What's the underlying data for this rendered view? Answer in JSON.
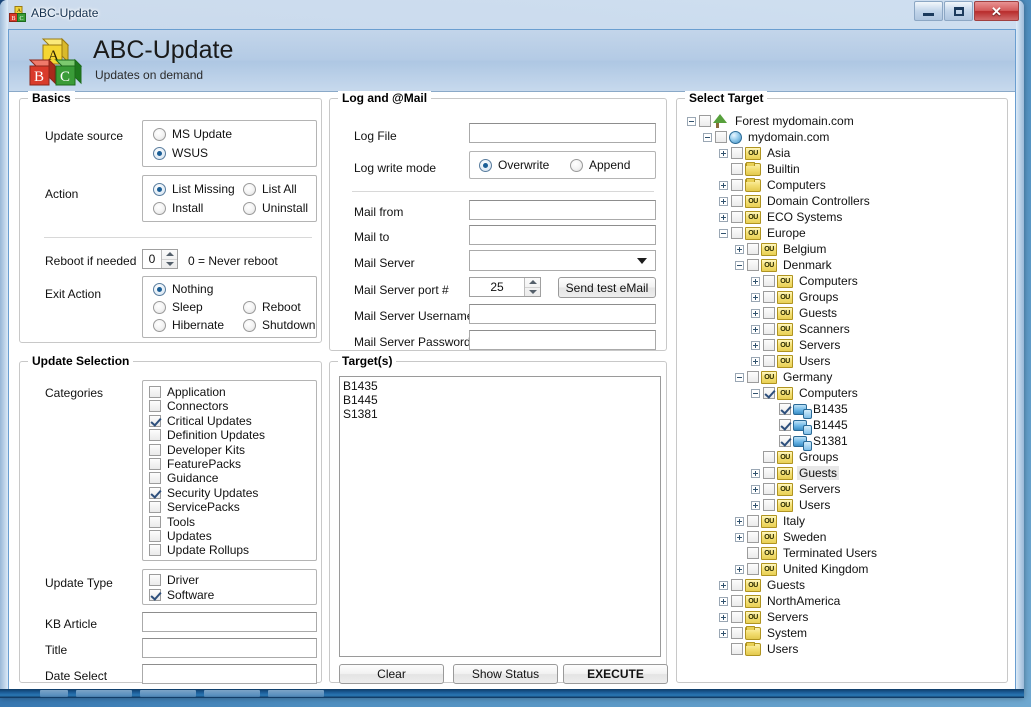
{
  "window": {
    "title": "ABC-Update",
    "icon": "abc-blocks-icon",
    "controls": {
      "minimize": "Minimize",
      "maximize": "Maximize",
      "close": "Close"
    }
  },
  "banner": {
    "app_title": "ABC-Update",
    "subtitle": "Updates on demand",
    "logo": "abc-blocks-logo"
  },
  "basics": {
    "title": "Basics",
    "update_source": {
      "label": "Update source",
      "options": [
        {
          "label": "MS Update",
          "selected": false
        },
        {
          "label": "WSUS",
          "selected": true
        }
      ]
    },
    "action": {
      "label": "Action",
      "options": [
        {
          "label": "List Missing",
          "selected": true
        },
        {
          "label": "List All",
          "selected": false
        },
        {
          "label": "Install",
          "selected": false
        },
        {
          "label": "Uninstall",
          "selected": false
        }
      ]
    },
    "reboot": {
      "label": "Reboot if needed",
      "value": "0",
      "hint": "0 = Never reboot"
    },
    "exit_action": {
      "label": "Exit Action",
      "options": [
        {
          "label": "Nothing",
          "selected": true
        },
        {
          "label": "Sleep",
          "selected": false
        },
        {
          "label": "Reboot",
          "selected": false
        },
        {
          "label": "Hibernate",
          "selected": false
        },
        {
          "label": "Shutdown",
          "selected": false
        }
      ]
    }
  },
  "update_selection": {
    "title": "Update Selection",
    "categories_label": "Categories",
    "categories": [
      {
        "label": "Application",
        "checked": false
      },
      {
        "label": "Connectors",
        "checked": false
      },
      {
        "label": "Critical Updates",
        "checked": true
      },
      {
        "label": "Definition Updates",
        "checked": false
      },
      {
        "label": "Developer Kits",
        "checked": false
      },
      {
        "label": "FeaturePacks",
        "checked": false
      },
      {
        "label": "Guidance",
        "checked": false
      },
      {
        "label": "Security Updates",
        "checked": true
      },
      {
        "label": "ServicePacks",
        "checked": false
      },
      {
        "label": "Tools",
        "checked": false
      },
      {
        "label": "Updates",
        "checked": false
      },
      {
        "label": "Update Rollups",
        "checked": false
      }
    ],
    "update_type_label": "Update Type",
    "update_types": [
      {
        "label": "Driver",
        "checked": false
      },
      {
        "label": "Software",
        "checked": true
      }
    ],
    "kb_article": {
      "label": "KB Article",
      "value": ""
    },
    "title_field": {
      "label": "Title",
      "value": ""
    },
    "date_select": {
      "label": "Date Select",
      "value": ""
    }
  },
  "log_mail": {
    "title": "Log  and  @Mail",
    "log_file": {
      "label": "Log File",
      "value": ""
    },
    "log_write_mode": {
      "label": "Log write mode",
      "options": [
        {
          "label": "Overwrite",
          "selected": true
        },
        {
          "label": "Append",
          "selected": false
        }
      ]
    },
    "mail_from": {
      "label": "Mail from",
      "value": ""
    },
    "mail_to": {
      "label": "Mail to",
      "value": ""
    },
    "mail_server": {
      "label": "Mail Server",
      "value": ""
    },
    "mail_server_port": {
      "label": "Mail Server port #",
      "value": "25"
    },
    "send_test_button": "Send test eMail",
    "mail_username": {
      "label": "Mail Server Username",
      "value": ""
    },
    "mail_password": {
      "label": "Mail Server Password",
      "value": ""
    }
  },
  "targets": {
    "title": "Target(s)",
    "items": [
      "B1435",
      "B1445",
      "S1381"
    ],
    "buttons": {
      "clear": "Clear",
      "show_status": "Show Status",
      "execute": "EXECUTE"
    }
  },
  "select_target": {
    "title": "Select Target",
    "tree": [
      {
        "label": "Forest mydomain.com",
        "depth": 0,
        "expander": "minus",
        "checkbox": false,
        "icon": "tree-icon",
        "highlight": false
      },
      {
        "label": "mydomain.com",
        "depth": 1,
        "expander": "minus",
        "checkbox": false,
        "icon": "globe-icon",
        "highlight": false
      },
      {
        "label": "Asia",
        "depth": 2,
        "expander": "plus",
        "checkbox": false,
        "icon": "ou-icon",
        "highlight": false
      },
      {
        "label": "Builtin",
        "depth": 2,
        "expander": "none",
        "checkbox": false,
        "icon": "folder-icon",
        "highlight": false
      },
      {
        "label": "Computers",
        "depth": 2,
        "expander": "plus",
        "checkbox": false,
        "icon": "folder-icon",
        "highlight": false
      },
      {
        "label": "Domain Controllers",
        "depth": 2,
        "expander": "plus",
        "checkbox": false,
        "icon": "ou-icon",
        "highlight": false
      },
      {
        "label": "ECO Systems",
        "depth": 2,
        "expander": "plus",
        "checkbox": false,
        "icon": "ou-icon",
        "highlight": false
      },
      {
        "label": "Europe",
        "depth": 2,
        "expander": "minus",
        "checkbox": false,
        "icon": "ou-icon",
        "highlight": false
      },
      {
        "label": "Belgium",
        "depth": 3,
        "expander": "plus",
        "checkbox": false,
        "icon": "ou-icon",
        "highlight": false
      },
      {
        "label": "Denmark",
        "depth": 3,
        "expander": "minus",
        "checkbox": false,
        "icon": "ou-icon",
        "highlight": false
      },
      {
        "label": "Computers",
        "depth": 4,
        "expander": "plus",
        "checkbox": false,
        "icon": "ou-icon",
        "highlight": false
      },
      {
        "label": "Groups",
        "depth": 4,
        "expander": "plus",
        "checkbox": false,
        "icon": "ou-icon",
        "highlight": false
      },
      {
        "label": "Guests",
        "depth": 4,
        "expander": "plus",
        "checkbox": false,
        "icon": "ou-icon",
        "highlight": false
      },
      {
        "label": "Scanners",
        "depth": 4,
        "expander": "plus",
        "checkbox": false,
        "icon": "ou-icon",
        "highlight": false
      },
      {
        "label": "Servers",
        "depth": 4,
        "expander": "plus",
        "checkbox": false,
        "icon": "ou-icon",
        "highlight": false
      },
      {
        "label": "Users",
        "depth": 4,
        "expander": "plus",
        "checkbox": false,
        "icon": "ou-icon",
        "highlight": false
      },
      {
        "label": "Germany",
        "depth": 3,
        "expander": "minus",
        "checkbox": false,
        "icon": "ou-icon",
        "highlight": false
      },
      {
        "label": "Computers",
        "depth": 4,
        "expander": "minus",
        "checkbox": true,
        "icon": "ou-icon",
        "highlight": false
      },
      {
        "label": "B1435",
        "depth": 5,
        "expander": "none",
        "checkbox": true,
        "icon": "computer-icon",
        "highlight": false
      },
      {
        "label": "B1445",
        "depth": 5,
        "expander": "none",
        "checkbox": true,
        "icon": "computer-icon",
        "highlight": false
      },
      {
        "label": "S1381",
        "depth": 5,
        "expander": "none",
        "checkbox": true,
        "icon": "computer-icon",
        "highlight": false
      },
      {
        "label": "Groups",
        "depth": 4,
        "expander": "none",
        "checkbox": false,
        "icon": "ou-icon",
        "highlight": false
      },
      {
        "label": "Guests",
        "depth": 4,
        "expander": "plus",
        "checkbox": false,
        "icon": "ou-icon",
        "highlight": true
      },
      {
        "label": "Servers",
        "depth": 4,
        "expander": "plus",
        "checkbox": false,
        "icon": "ou-icon",
        "highlight": false
      },
      {
        "label": "Users",
        "depth": 4,
        "expander": "plus",
        "checkbox": false,
        "icon": "ou-icon",
        "highlight": false
      },
      {
        "label": "Italy",
        "depth": 3,
        "expander": "plus",
        "checkbox": false,
        "icon": "ou-icon",
        "highlight": false
      },
      {
        "label": "Sweden",
        "depth": 3,
        "expander": "plus",
        "checkbox": false,
        "icon": "ou-icon",
        "highlight": false
      },
      {
        "label": "Terminated Users",
        "depth": 3,
        "expander": "none",
        "checkbox": false,
        "icon": "ou-icon",
        "highlight": false
      },
      {
        "label": "United Kingdom",
        "depth": 3,
        "expander": "plus",
        "checkbox": false,
        "icon": "ou-icon",
        "highlight": false
      },
      {
        "label": "Guests",
        "depth": 2,
        "expander": "plus",
        "checkbox": false,
        "icon": "ou-icon",
        "highlight": false
      },
      {
        "label": "NorthAmerica",
        "depth": 2,
        "expander": "plus",
        "checkbox": false,
        "icon": "ou-icon",
        "highlight": false
      },
      {
        "label": "Servers",
        "depth": 2,
        "expander": "plus",
        "checkbox": false,
        "icon": "ou-icon",
        "highlight": false
      },
      {
        "label": "System",
        "depth": 2,
        "expander": "plus",
        "checkbox": false,
        "icon": "folder-icon",
        "highlight": false
      },
      {
        "label": "Users",
        "depth": 2,
        "expander": "none",
        "checkbox": false,
        "icon": "folder-icon",
        "highlight": false
      }
    ]
  },
  "colors": {
    "banner_top": "#c3d5ea",
    "banner_bottom": "#c7d9ed",
    "accent_radio": "#1b5e96",
    "close_button": "#b82b2b",
    "ou_icon": "#e8cf55",
    "computer_icon": "#6ab6e6"
  }
}
